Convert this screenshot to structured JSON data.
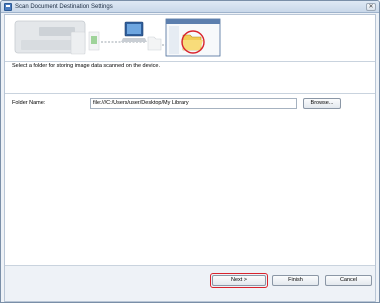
{
  "window": {
    "title": "Scan Document Destination Settings"
  },
  "titlebar": {
    "close_glyph": "✕"
  },
  "icons": {
    "app": "scanner-app-icon",
    "scanner": "scanner-icon",
    "computer": "computer-icon",
    "folder": "folder-icon",
    "selected_folder": "folder-icon"
  },
  "colors": {
    "highlight": "#d9232d",
    "title_bar": "#cfdcec"
  },
  "main": {
    "instruction": "Select a folder for storing image data scanned on the device."
  },
  "folder": {
    "label": "Folder Name:",
    "value": "file:///C:/Users/user/Desktop/My Library",
    "browse_label": "Browse..."
  },
  "footer": {
    "next_label": "Next >",
    "finish_label": "Finish",
    "cancel_label": "Cancel"
  }
}
